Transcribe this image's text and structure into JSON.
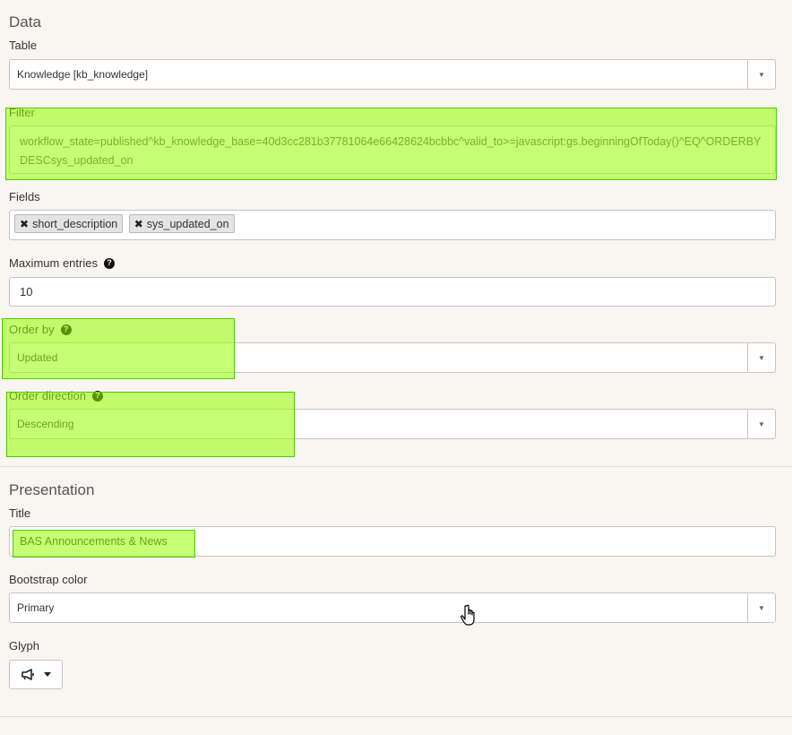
{
  "data_section": {
    "title": "Data",
    "table": {
      "label": "Table",
      "value": "Knowledge [kb_knowledge]"
    },
    "filter": {
      "label": "Filter",
      "value": "workflow_state=published^kb_knowledge_base=40d3cc281b37781064e66428624bcbbc^valid_to>=javascript:gs.beginningOfToday()^EQ^ORDERBYDESCsys_updated_on"
    },
    "fields": {
      "label": "Fields",
      "tags": [
        "short_description",
        "sys_updated_on"
      ]
    },
    "max_entries": {
      "label": "Maximum entries",
      "value": "10"
    },
    "order_by": {
      "label": "Order by",
      "value": "Updated"
    },
    "order_direction": {
      "label": "Order direction",
      "value": "Descending"
    }
  },
  "presentation_section": {
    "title": "Presentation",
    "title_field": {
      "label": "Title",
      "value": "BAS Announcements & News"
    },
    "bootstrap_color": {
      "label": "Bootstrap color",
      "value": "Primary"
    },
    "glyph": {
      "label": "Glyph",
      "icon": "megaphone-icon"
    }
  },
  "icons": {
    "remove": "✖",
    "help": "?",
    "arrow": "▼"
  },
  "colors": {
    "highlight": "#96ff00",
    "highlight_border": "#4ecb00",
    "background": "#f9f6f2"
  }
}
